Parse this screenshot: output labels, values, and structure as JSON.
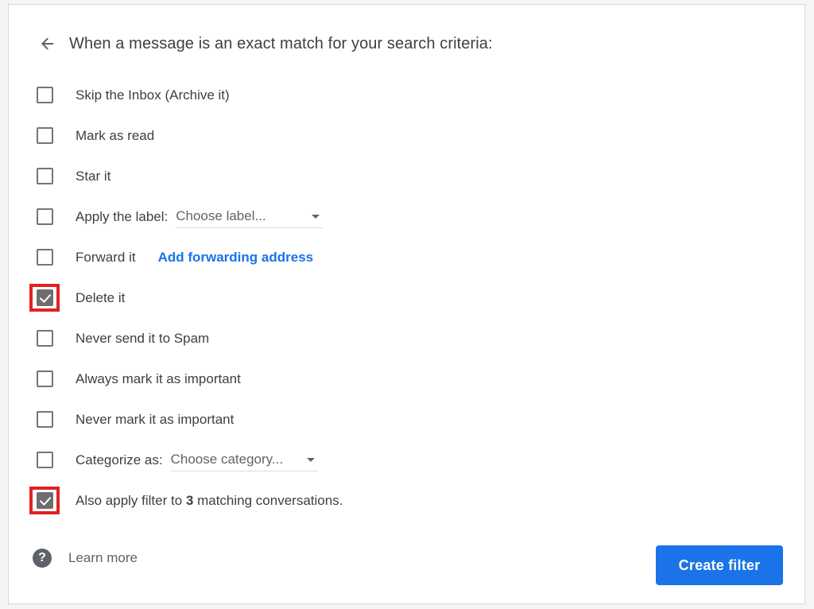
{
  "header": {
    "back_icon": "arrow-left-icon",
    "title": "When a message is an exact match for your search criteria:"
  },
  "options": [
    {
      "label": "Skip the Inbox (Archive it)",
      "checked": false,
      "highlighted": false
    },
    {
      "label": "Mark as read",
      "checked": false,
      "highlighted": false
    },
    {
      "label": "Star it",
      "checked": false,
      "highlighted": false
    },
    {
      "label": "Apply the label:",
      "checked": false,
      "highlighted": false,
      "select": "Choose label..."
    },
    {
      "label": "Forward it",
      "checked": false,
      "highlighted": false,
      "link": "Add forwarding address"
    },
    {
      "label": "Delete it",
      "checked": true,
      "highlighted": true
    },
    {
      "label": "Never send it to Spam",
      "checked": false,
      "highlighted": false
    },
    {
      "label": "Always mark it as important",
      "checked": false,
      "highlighted": false
    },
    {
      "label": "Never mark it as important",
      "checked": false,
      "highlighted": false
    },
    {
      "label": "Categorize as:",
      "checked": false,
      "highlighted": false,
      "select": "Choose category..."
    }
  ],
  "apply_existing": {
    "prefix": "Also apply filter to ",
    "count": "3",
    "suffix": " matching conversations.",
    "checked": true,
    "highlighted": true
  },
  "footer": {
    "help_icon": "question-mark-icon",
    "learn_more_label": "Learn more",
    "create_filter_label": "Create filter"
  },
  "colors": {
    "accent_blue": "#1a73e8",
    "highlight_red": "#e12222",
    "checkbox_gray": "#6e6e6e",
    "text_primary": "#3c4043",
    "text_secondary": "#5f6368"
  }
}
